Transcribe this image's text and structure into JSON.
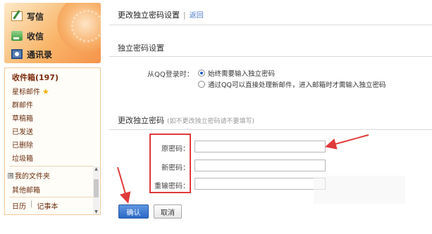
{
  "sidebar": {
    "quick_actions": [
      {
        "label": "写信",
        "icon": "write-icon"
      },
      {
        "label": "收信",
        "icon": "receive-icon"
      },
      {
        "label": "通讯录",
        "icon": "address-book-icon"
      }
    ],
    "folders": [
      {
        "label": "收件箱(197)"
      },
      {
        "label": "星标邮件"
      },
      {
        "label": "群邮件"
      },
      {
        "label": "草稿箱"
      },
      {
        "label": "已发送"
      },
      {
        "label": "已删除"
      },
      {
        "label": "垃圾箱"
      }
    ],
    "my_folders_label": "我的文件夹",
    "plus_glyph": "⊞",
    "other_mail_label": "其他邮箱",
    "calendar_label": "日历",
    "divider_glyph": "|",
    "notes_label": "记事本"
  },
  "header": {
    "title": "更改独立密码设置",
    "sep": "|",
    "back_label": "返回"
  },
  "section1": {
    "title": "独立密码设置",
    "option_label": "从QQ登录时：",
    "options": [
      {
        "label": "始终需要输入独立密码",
        "checked": true
      },
      {
        "label": "通过QQ可以直接处理新邮件，进入邮箱时才需输入独立密码",
        "checked": false
      }
    ]
  },
  "section2": {
    "title": "更改独立密码",
    "note": "(如不更改独立密码请不要填写)",
    "fields": [
      {
        "label": "原密码：",
        "value": ""
      },
      {
        "label": "新密码：",
        "value": ""
      },
      {
        "label": "重输密码：",
        "value": ""
      }
    ]
  },
  "buttons": {
    "confirm": "确认",
    "cancel": "取消"
  },
  "colors": {
    "annotation_red": "#e03a3a",
    "primary_blue": "#2c69c6"
  }
}
